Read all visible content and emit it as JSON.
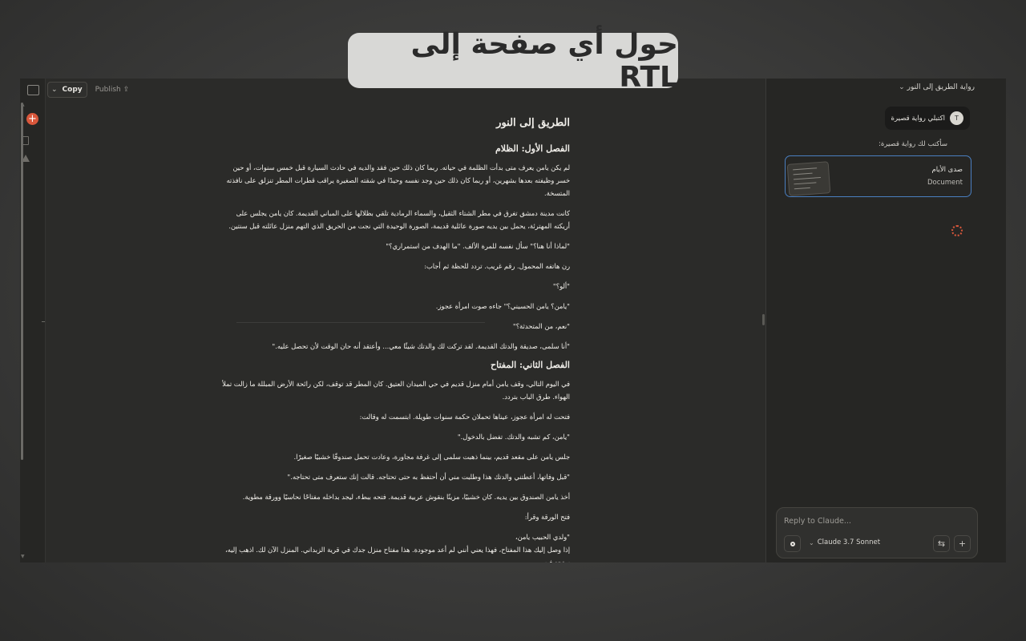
{
  "banner": {
    "text": "حول أي صفحة إلى RTL"
  },
  "toolbar": {
    "copy_label": "Copy",
    "publish_label": "Publish"
  },
  "document": {
    "title": "الطريق إلى النور",
    "chapter1_title": "الفصل الأول: الظلام",
    "p1": "لم يكن يامن يعرف متى بدأت الظلمة في حياته. ربما كان ذلك حين فقد والديه في حادث السيارة قبل خمس سنوات، أو حين خسر وظيفته بعدها بشهرين، أو ربما كان ذلك حين وجد نفسه وحيدًا في شقته الصغيرة يراقب قطرات المطر تنزلق على نافذته المتسخة.",
    "p2": "كانت مدينة دمشق تغرق في مطر الشتاء الثقيل، والسماء الرمادية تلقي بظلالها على المباني القديمة. كان يامن يجلس على أريكته المهترئة، يحمل بين يديه صورة عائلية قديمة، الصورة الوحيدة التي نجت من الحريق الذي التهم منزل عائلته قبل سنتين.",
    "p3": "\"لماذا أنا هنا؟\" سأل نفسه للمرة الألف. \"ما الهدف من استمراري؟\"",
    "p4": "رن هاتفه المحمول. رقم غريب. تردد للحظة ثم أجاب:",
    "p5": "\"ألو؟\"",
    "p6": "\"يامن؟ يامن الحسيني؟\" جاءه صوت امرأة عجوز.",
    "p7": "\"نعم، من المتحدثة؟\"",
    "p8": "\"أنا سلمى، صديقة والدتك القديمة. لقد تركت لك والدتك شيئًا معي... وأعتقد أنه حان الوقت لأن تحصل عليه.\"",
    "chapter2_title": "الفصل الثاني: المفتاح",
    "p9": "في اليوم التالي، وقف يامن أمام منزل قديم في حي الميدان العتيق. كان المطر قد توقف، لكن رائحة الأرض المبللة ما زالت تملأ الهواء. طرق الباب بتردد.",
    "p10": "فتحت له امرأة عجوز، عيناها تحملان حكمة سنوات طويلة. ابتسمت له وقالت:",
    "p11": "\"يامن، كم تشبه والدتك. تفضل بالدخول.\"",
    "p12": "جلس يامن على مقعد قديم، بينما ذهبت سلمى إلى غرفة مجاورة، وعادت تحمل صندوقًا خشبيًا صغيرًا.",
    "p13": "\"قبل وفاتها، أعطتني والدتك هذا وطلبت مني أن أحتفظ به حتى تحتاجه. قالت إنك ستعرف متى تحتاجه.\"",
    "p14": "أخذ يامن الصندوق بين يديه. كان خشبيًا، مزينًا بنقوش عربية قديمة. فتحه ببطء، ليجد بداخله مفتاحًا نحاسيًا وورقة مطوية.",
    "p15": "فتح الورقة وقرأ:",
    "p16": "\"ولدي الحبيب يامن،",
    "p17": "إذا وصل إليك هذا المفتاح، فهذا يعني أنني لم أعد موجودة. هذا مفتاح منزل جدك في قرية الزبداني. المنزل الآن لك. اذهب إليه، ستجد فيه"
  },
  "panel": {
    "title": "رواية الطريق إلى النور",
    "user_avatar": "T",
    "user_message": "اكتبلي رواية قصيرة",
    "assistant_message": "سأكتب لك رواية قصيرة:",
    "artifact_title": "صدى الأيام",
    "artifact_type": "Document",
    "composer_placeholder": "Reply to Claude...",
    "model_name": "Claude 3.7 Sonnet"
  }
}
